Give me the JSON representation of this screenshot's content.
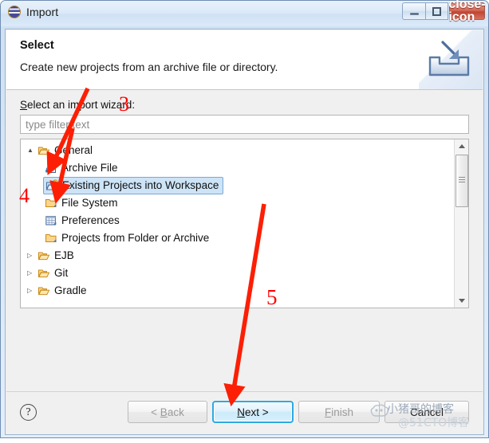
{
  "window": {
    "title": "Import",
    "app_icon": "eclipse-icon",
    "caption_buttons": [
      {
        "name": "minimize-button",
        "glyph": "minimize-icon",
        "label": "Minimize"
      },
      {
        "name": "maximize-button",
        "glyph": "maximize-icon",
        "label": "Maximize"
      },
      {
        "name": "close-button",
        "glyph": "close-icon",
        "label": "✕"
      }
    ]
  },
  "header": {
    "title": "Select",
    "description": "Create new projects from an archive file or directory.",
    "banner_icon": "import-arrow-icon"
  },
  "body": {
    "tree_label_prefix": "S",
    "tree_label_rest": "elect an import wizard:",
    "filter": {
      "value": "",
      "placeholder": "type filter text"
    },
    "tree": [
      {
        "label": "General",
        "icon": "folder-open-icon",
        "twisty": "▲",
        "expanded": true,
        "level": 0,
        "selected": false
      },
      {
        "label": "Archive File",
        "icon": "archive-file-icon",
        "twisty": "",
        "expanded": false,
        "level": 1,
        "selected": false
      },
      {
        "label": "Existing Projects into Workspace",
        "icon": "projects-import-icon",
        "twisty": "",
        "expanded": false,
        "level": 1,
        "selected": true
      },
      {
        "label": "File System",
        "icon": "folder-icon",
        "twisty": "",
        "expanded": false,
        "level": 1,
        "selected": false
      },
      {
        "label": "Preferences",
        "icon": "preferences-icon",
        "twisty": "",
        "expanded": false,
        "level": 1,
        "selected": false
      },
      {
        "label": "Projects from Folder or Archive",
        "icon": "folder-icon",
        "twisty": "",
        "expanded": false,
        "level": 1,
        "selected": false
      },
      {
        "label": "EJB",
        "icon": "folder-open-icon",
        "twisty": "▷",
        "expanded": false,
        "level": 0,
        "selected": false
      },
      {
        "label": "Git",
        "icon": "folder-open-icon",
        "twisty": "▷",
        "expanded": false,
        "level": 0,
        "selected": false
      },
      {
        "label": "Gradle",
        "icon": "folder-open-icon",
        "twisty": "▷",
        "expanded": false,
        "level": 0,
        "selected": false
      }
    ],
    "scrollbar": {
      "up_arrow": "scroll-up-icon",
      "down_arrow": "scroll-down-icon"
    }
  },
  "buttonbar": {
    "help_glyph": "?",
    "buttons": [
      {
        "name": "back-button",
        "label": "< Back",
        "mnemonic": "B",
        "enabled": false,
        "focused": false
      },
      {
        "name": "next-button",
        "label": "Next >",
        "mnemonic": "N",
        "enabled": true,
        "focused": true
      },
      {
        "name": "finish-button",
        "label": "Finish",
        "mnemonic": "F",
        "enabled": false,
        "focused": false
      },
      {
        "name": "cancel-button",
        "label": "Cancel",
        "mnemonic": "",
        "enabled": true,
        "focused": false
      }
    ]
  },
  "annotations": {
    "numbers": [
      {
        "text": "3"
      },
      {
        "text": "4"
      },
      {
        "text": "5"
      }
    ],
    "color": "#ff0000",
    "arrow_count": 3
  },
  "watermark": {
    "line1": "小猪哥的博客",
    "line2": "@51CTO博客"
  }
}
